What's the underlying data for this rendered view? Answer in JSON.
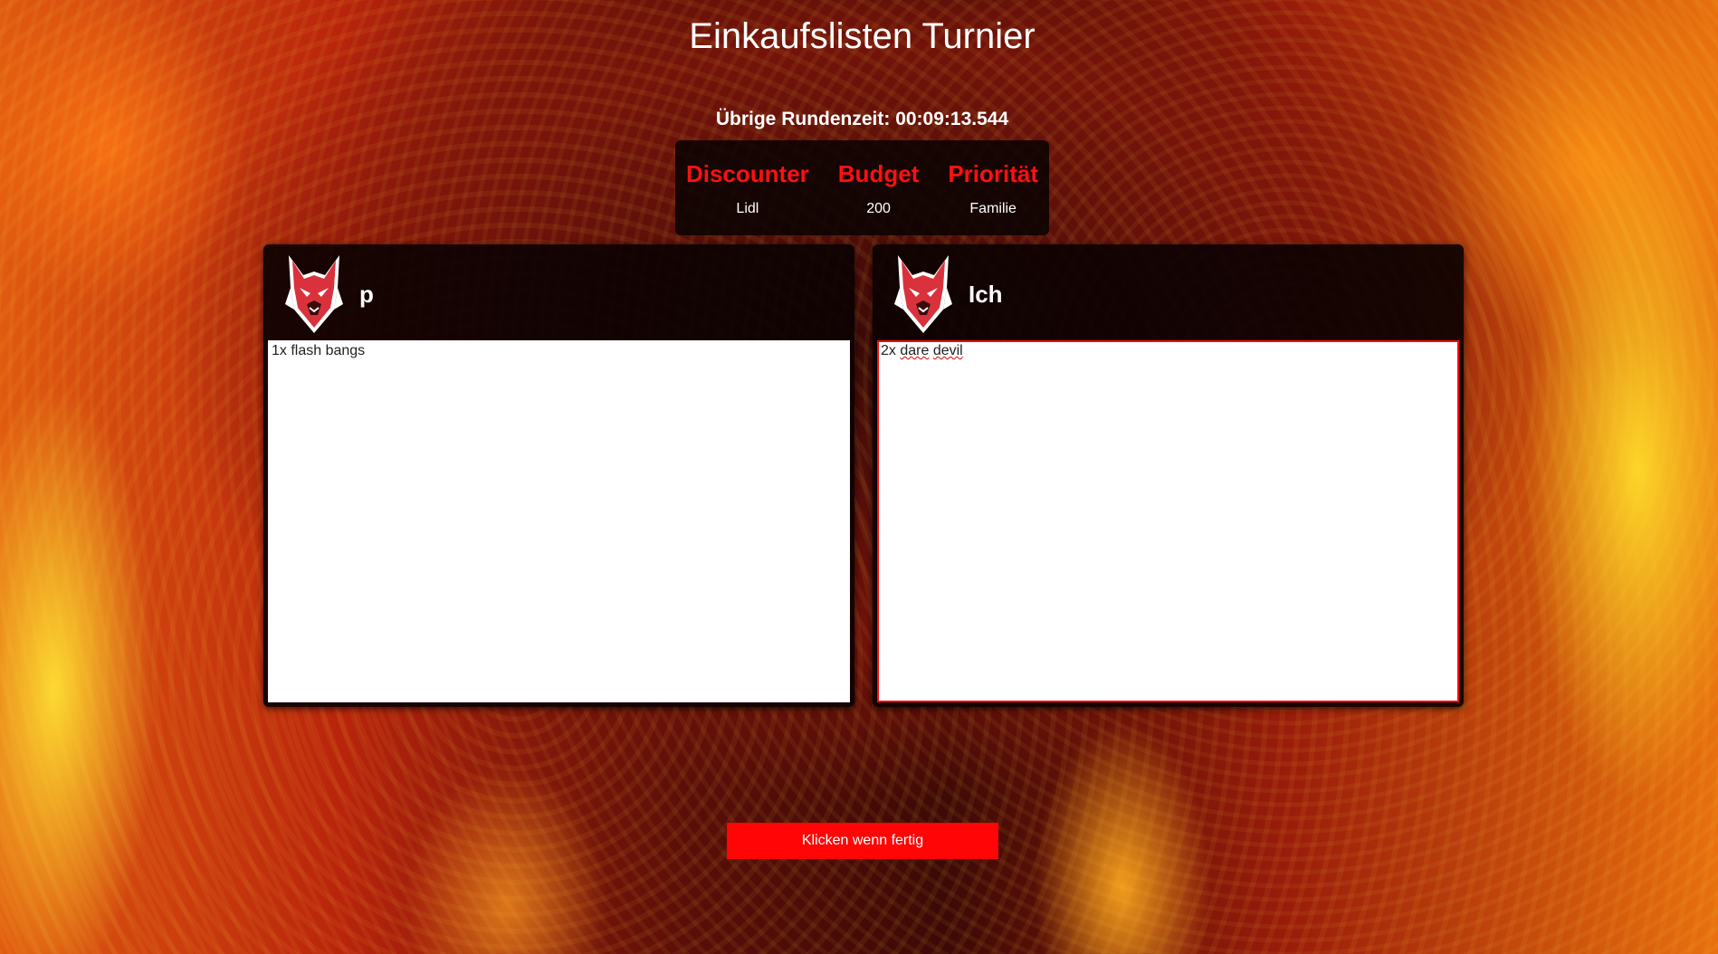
{
  "title": "Einkaufslisten Turnier",
  "timer": {
    "text": "Übrige Rundenzeit: 00:09:13.544"
  },
  "info": {
    "discounter_label": "Discounter",
    "discounter_value": "Lidl",
    "budget_label": "Budget",
    "budget_value": "200",
    "priority_label": "Priorität",
    "priority_value": "Familie"
  },
  "players": [
    {
      "name": "p",
      "list_text": "1x flash bangs",
      "avatar_icon": "wolf-mascot-icon"
    },
    {
      "name": "Ich",
      "list_prefix": "2x ",
      "list_word1": "dare",
      "list_space": " ",
      "list_word2": "devil",
      "avatar_icon": "wolf-mascot-icon"
    }
  ],
  "done_button": "Klicken wenn fertig",
  "colors": {
    "accent": "#ff0505",
    "label_red": "#ff1010",
    "panel_bg": "#0c0202"
  }
}
